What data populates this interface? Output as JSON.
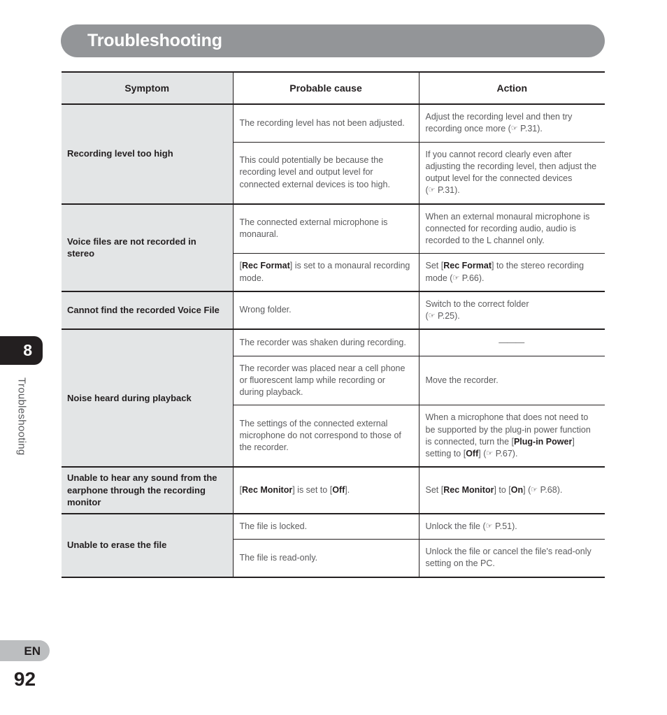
{
  "page": {
    "title": "Troubleshooting",
    "chapter_number": "8",
    "chapter_vertical_label": "Troubleshooting",
    "language_badge": "EN",
    "page_number": "92",
    "colors": {
      "title_bar": "#939598",
      "chapter_tab": "#231f20",
      "language_badge": "#bcbec0",
      "symptom_cell": "#e3e5e6",
      "body_text": "#5b5b5d",
      "heading_text": "#231f20"
    }
  },
  "table": {
    "headers": {
      "symptom": "Symptom",
      "cause": "Probable cause",
      "action": "Action"
    },
    "groups": [
      {
        "symptom": "Recording level too high",
        "rows": [
          {
            "cause_html": "The recording level has not been adjusted.",
            "action_html": "Adjust the recording level and then try recording once more (<span class=\"ref\"><span class=\"hand\">☞</span> P.31)</span>."
          },
          {
            "cause_html": "This could potentially be because the recording level and output level for connected external devices is too high.",
            "action_html": "If you cannot record clearly even after adjusting the recording level, then adjust the output level for the connected devices (<span class=\"ref\"><span class=\"hand\">☞</span> P.31)</span>."
          }
        ]
      },
      {
        "symptom": "Voice files are not recorded in stereo",
        "rows": [
          {
            "cause_html": "The connected external microphone is monaural.",
            "action_html": "When an external monaural microphone is connected for recording audio, audio is recorded to the L channel only."
          },
          {
            "cause_html": "[<b class=\"ui\">Rec Format</b>] is set to a monaural recording mode.",
            "action_html": "Set [<b class=\"ui\">Rec Format</b>] to the stereo recording mode (<span class=\"ref\"><span class=\"hand\">☞</span> P.66)</span>."
          }
        ]
      },
      {
        "symptom": "Cannot find the recorded Voice File",
        "rows": [
          {
            "cause_html": "Wrong folder.",
            "action_html": "Switch to the correct folder<br>(<span class=\"ref\"><span class=\"hand\">☞</span> P.25)</span>."
          }
        ]
      },
      {
        "symptom": "Noise heard during playback",
        "rows": [
          {
            "cause_html": "The recorder was shaken during recording.",
            "action_html": "<span class=\"emdash\">———</span>",
            "action_is_dash": true
          },
          {
            "cause_html": "The recorder was placed near a cell phone or fluorescent lamp while recording or during playback.",
            "action_html": "Move the recorder."
          },
          {
            "cause_html": "The settings of the connected external microphone do not correspond to those of the recorder.",
            "action_html": "When a microphone that does not need to be supported by the plug-in power function is connected, turn the [<b class=\"ui\">Plug-in Power</b>] setting to [<b class=\"ui\">Off</b>] (<span class=\"ref\"><span class=\"hand\">☞</span> P.67)</span>."
          }
        ]
      },
      {
        "symptom": "Unable to hear any sound from the earphone through the recording monitor",
        "rows": [
          {
            "cause_html": "[<b class=\"ui\">Rec Monitor</b>] is set to [<b class=\"ui\">Off</b>].",
            "action_html": "Set [<b class=\"ui\">Rec Monitor</b>] to [<b class=\"ui\">On</b>] (<span class=\"ref\"><span class=\"hand\">☞</span> P.68)</span>."
          }
        ]
      },
      {
        "symptom": "Unable to erase the file",
        "rows": [
          {
            "cause_html": "The file is locked.",
            "action_html": "Unlock the file (<span class=\"ref\"><span class=\"hand\">☞</span> P.51)</span>."
          },
          {
            "cause_html": "The file is read-only.",
            "action_html": "Unlock the file or cancel the file's read-only setting on the PC."
          }
        ]
      }
    ]
  }
}
